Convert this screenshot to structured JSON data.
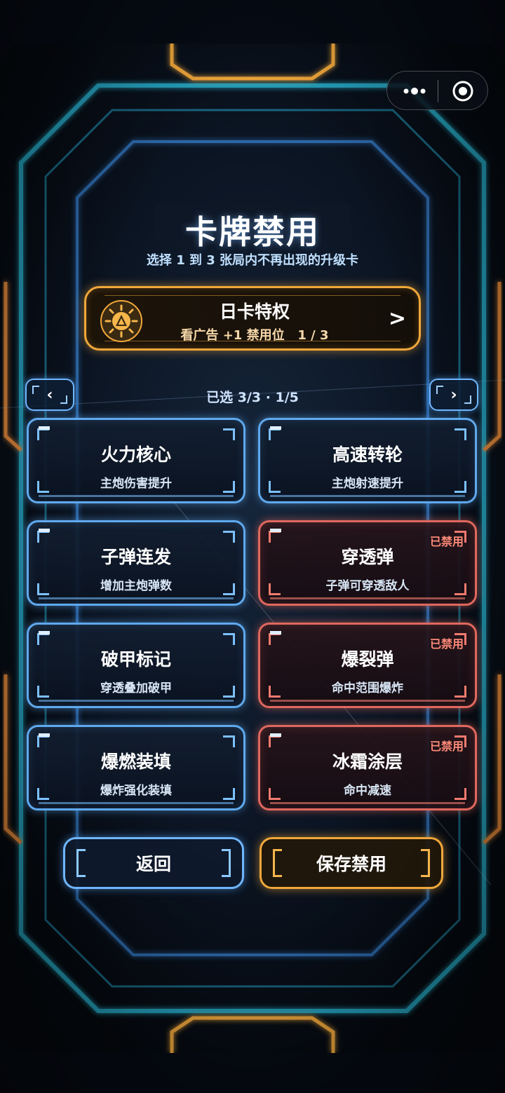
{
  "header": {
    "title": "卡牌禁用",
    "subtitle": "选择 1 到 3 张局内不再出现的升级卡"
  },
  "privilege": {
    "title": "日卡特权",
    "description": "看广告 +1 禁用位   1 / 3",
    "arrow": ">",
    "icon": "sun-warning-icon"
  },
  "pager": {
    "prev_label": "‹",
    "next_label": "›",
    "info": "已选 3/3 · 1/5"
  },
  "cards": [
    {
      "name": "火力核心",
      "desc": "主炮伤害提升",
      "banned": false,
      "badge": ""
    },
    {
      "name": "高速转轮",
      "desc": "主炮射速提升",
      "banned": false,
      "badge": ""
    },
    {
      "name": "子弹连发",
      "desc": "增加主炮弹数",
      "banned": false,
      "badge": ""
    },
    {
      "name": "穿透弹",
      "desc": "子弹可穿透敌人",
      "banned": true,
      "badge": "已禁用"
    },
    {
      "name": "破甲标记",
      "desc": "穿透叠加破甲",
      "banned": false,
      "badge": ""
    },
    {
      "name": "爆裂弹",
      "desc": "命中范围爆炸",
      "banned": true,
      "badge": "已禁用"
    },
    {
      "name": "爆燃装填",
      "desc": "爆炸强化装填",
      "banned": false,
      "badge": ""
    },
    {
      "name": "冰霜涂层",
      "desc": "命中减速",
      "banned": true,
      "badge": "已禁用"
    }
  ],
  "buttons": {
    "back": "返回",
    "save": "保存禁用"
  },
  "colors": {
    "accent_blue": "#5fa9ee",
    "accent_orange": "#f0a73a",
    "banned_red": "#e0685e",
    "background": "#060b14"
  }
}
